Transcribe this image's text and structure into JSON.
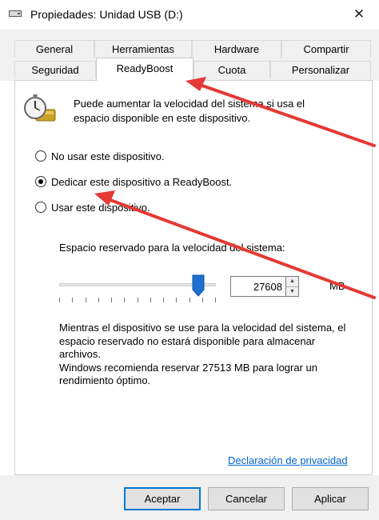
{
  "window": {
    "title": "Propiedades: Unidad USB (D:)",
    "close_glyph": "✕"
  },
  "tabs": {
    "row1": [
      {
        "label": "General"
      },
      {
        "label": "Herramientas"
      },
      {
        "label": "Hardware"
      },
      {
        "label": "Compartir"
      }
    ],
    "row2": [
      {
        "label": "Seguridad"
      },
      {
        "label": "ReadyBoost",
        "active": true
      },
      {
        "label": "Cuota"
      },
      {
        "label": "Personalizar"
      }
    ]
  },
  "readyboost": {
    "intro": "Puede aumentar la velocidad del sistema si usa el espacio disponible en este dispositivo.",
    "options": [
      {
        "label": "No usar este dispositivo.",
        "checked": false
      },
      {
        "label": "Dedicar este dispositivo a ReadyBoost.",
        "checked": true
      },
      {
        "label": "Usar este dispositivo.",
        "checked": false
      }
    ],
    "reserve_label": "Espacio reservado para la velocidad del sistema:",
    "reserve_value": "27608",
    "unit": "MB",
    "slider_fraction": 0.92,
    "note_1": "Mientras el dispositivo se use para la velocidad del sistema, el espacio reservado no estará disponible para almacenar archivos.",
    "note_2": "Windows recomienda reservar 27513 MB para lograr un rendimiento óptimo.",
    "privacy_link": "Declaración de privacidad"
  },
  "buttons": {
    "ok": "Aceptar",
    "cancel": "Cancelar",
    "apply": "Aplicar"
  },
  "colors": {
    "accent": "#0078d7",
    "link": "#0066cc",
    "annotation_arrow": "#e53935"
  },
  "icons": {
    "title": "usb-drive-icon",
    "readyboost": "stopwatch-drive-icon"
  }
}
